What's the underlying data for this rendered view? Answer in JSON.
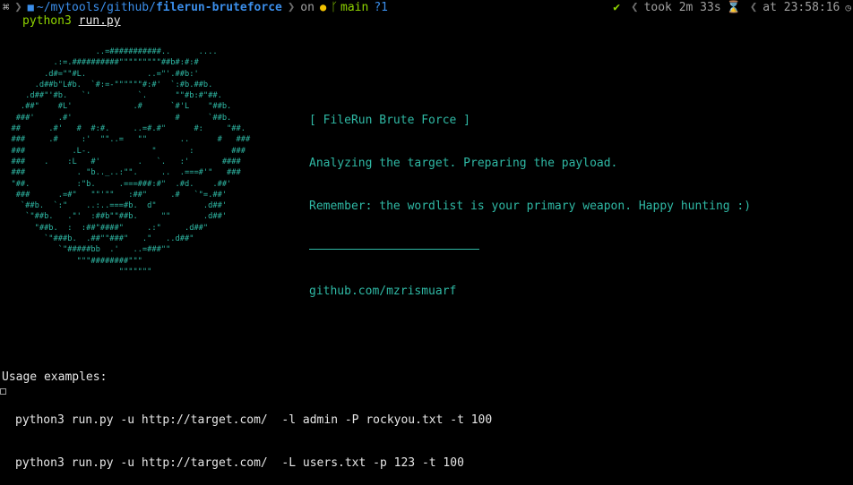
{
  "prompt": {
    "os_icon": "⌘",
    "folder_icon": "■",
    "path_prefix": "~/mytools/github/",
    "path_leaf": "filerun-bruteforce",
    "on_label": "on",
    "git_icon": "●",
    "branch_icon": "ᚴ",
    "branch": "main",
    "git_status": "?1",
    "status_ok_icon": "✔",
    "duration_label": "took 2m 33s",
    "hourglass_icon": "⌛",
    "time_label": "at 23:58:16",
    "clock_icon": "◷",
    "colors": {
      "path": "#3b8eea",
      "branch": "#8fd400",
      "git_icon": "#f2c200",
      "muted": "#a0a0a0"
    }
  },
  "command": {
    "name": "python3",
    "arg": "run.py"
  },
  "ascii_art": {
    "color": "#2fb9a5",
    "lines": [
      "                    ..=###########..      ....",
      "           .:=.##########\"\"\"\"\"\"\"\"\"##b#:#:#",
      "         .d#=\"\"#L.             ..=\"'.##b:'",
      "       .d##b\"L#b.  `#:=-\"\"\"\"\"\"#:#'  `:#b.##b.",
      "     .d##\"'#b.   `'          `.      \"\"#b:#\"##.",
      "    .##\"    #L'             .#      `#'L    \"##b.",
      "   ###'     .#'                      #      `##b.",
      "  ##      .#'   #  #:#.     ..=#.#\"      #:     \"##.",
      "  ###     .#     :'  \"\"..=   \"\"       ..      #   ###",
      "  ###          .L-.             \"       :        ###",
      "  ###    .    :L   #'        .   `.   :'       ####",
      "  ###           . \"b.._..:\"\".     ..  .===#'\"   ###",
      "  \"##.          :\"b.     .===###:#\"  .#d.    .##'",
      "   ###      .=#\"   \"\"'\"\"   :##\"     .#   `\"=.##'",
      "    `##b.  `:\"    ..:..===#b.  d\"          .d##'",
      "     `\"##b.   .\"'  :##b\"\"##b.     \"\"       .d##'",
      "       \"##b.  :  :##\"####\"     .:\"     .d##\"",
      "         `\"###b.  .##\"\"###\"   .\"   ..d##\"",
      "            `\"#####bb  .'   ..=###\"\"",
      "                \"\"\"########\"\"\"",
      "                         \"\"\"\"\"\"\""
    ]
  },
  "banner": {
    "title": "[ FileRun Brute Force ]",
    "line1": "Analyzing the target. Preparing the payload.",
    "line2": "Remember: the wordlist is your primary weapon. Happy hunting :)",
    "link": "github.com/mzrismuarf"
  },
  "usage": {
    "title": "Usage examples:",
    "examples": [
      "python3 run.py -u http://target.com/  -l admin -P rockyou.txt -t 100",
      "python3 run.py -u http://target.com/  -L users.txt -p 123 -t 100"
    ]
  }
}
